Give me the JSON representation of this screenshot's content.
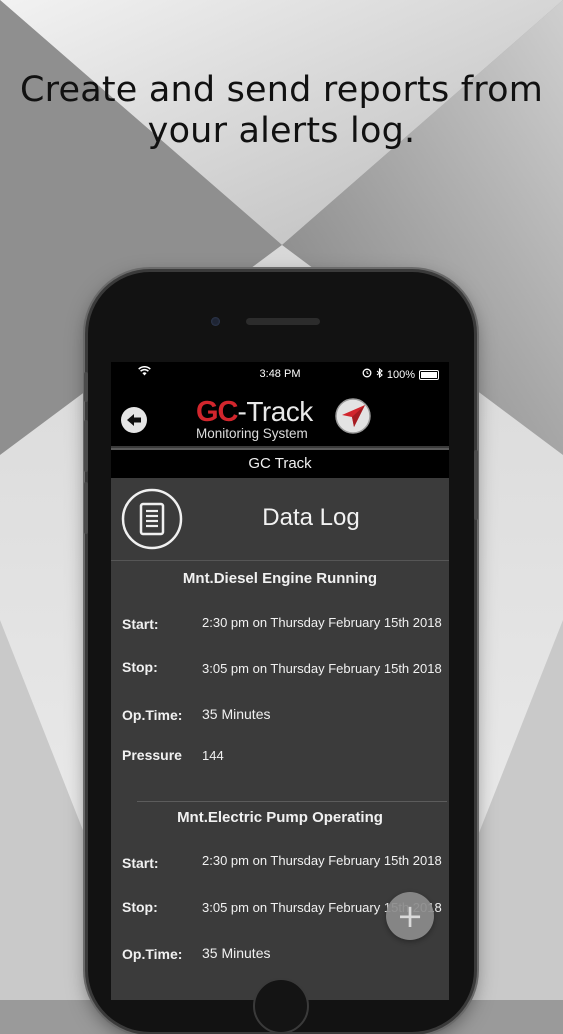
{
  "headline": {
    "line1": "Create and send reports from",
    "line2": "your alerts log."
  },
  "status_bar": {
    "time": "3:48 PM",
    "battery": "100%",
    "icons": [
      "wifi-icon",
      "alarm-icon",
      "bluetooth-icon",
      "battery-icon"
    ]
  },
  "app_header": {
    "logo_gc": "GC",
    "logo_track": "-Track",
    "logo_subtitle": "Monitoring System",
    "back_icon": "arrow-left-icon"
  },
  "title_bar": {
    "title": "GC Track"
  },
  "banner": {
    "title": "Data Log",
    "icon": "document-list-icon"
  },
  "entries": [
    {
      "title": "Mnt.Diesel Engine Running",
      "start_label": "Start:",
      "start_value": "2:30 pm on Thursday February 15th 2018",
      "stop_label": "Stop:",
      "stop_value": "3:05 pm on Thursday February 15th 2018",
      "optime_label": "Op.Time:",
      "optime_value": "35 Minutes",
      "extra_label": "Pressure",
      "extra_value": "144"
    },
    {
      "title": "Mnt.Electric Pump Operating",
      "start_label": "Start:",
      "start_value": "2:30 pm on Thursday February 15th 2018",
      "stop_label": "Stop:",
      "stop_value": "3:05 pm on Thursday February 15th 2018",
      "optime_label": "Op.Time:",
      "optime_value": "35 Minutes"
    }
  ],
  "fab": {
    "label": "+",
    "icon": "plus-icon"
  },
  "colors": {
    "brand_red": "#d2262d",
    "header_black": "#000000",
    "panel_gray": "#3b3b3b"
  }
}
